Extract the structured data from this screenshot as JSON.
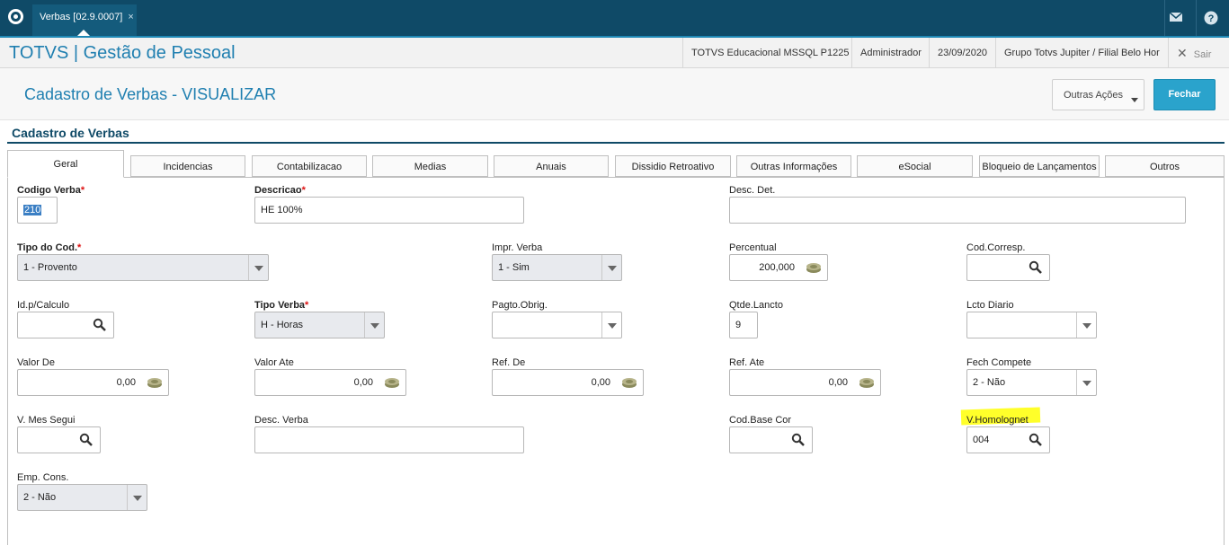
{
  "topbar": {
    "tab_label": "Verbas [02.9.0007]",
    "tab_close": "×",
    "mail_icon": "mail-icon",
    "help_icon": "help-icon"
  },
  "header": {
    "brand": "TOTVS | Gestão de Pessoal",
    "environment": "TOTVS Educacional MSSQL P1225",
    "user": "Administrador",
    "date": "23/09/2020",
    "company": "Grupo Totvs Jupiter / Filial Belo Hor",
    "exit_label": "Sair"
  },
  "titlebar": {
    "title": "Cadastro de Verbas - VISUALIZAR",
    "outras_acoes": "Outras Ações",
    "fechar": "Fechar"
  },
  "section_title": "Cadastro de Verbas",
  "tabs": [
    {
      "label": "Geral",
      "active": true
    },
    {
      "label": "Incidencias"
    },
    {
      "label": "Contabilizacao"
    },
    {
      "label": "Medias"
    },
    {
      "label": "Anuais"
    },
    {
      "label": "Dissidio Retroativo"
    },
    {
      "label": "Outras Informações"
    },
    {
      "label": "eSocial"
    },
    {
      "label": "Bloqueio de Lançamentos"
    },
    {
      "label": "Outros"
    }
  ],
  "fields": {
    "codigo_verba": {
      "label": "Codigo Verba",
      "value": "210"
    },
    "descricao": {
      "label": "Descricao",
      "value": "HE 100%"
    },
    "desc_det": {
      "label": "Desc. Det.",
      "value": ""
    },
    "tipo_cod": {
      "label": "Tipo do Cod.",
      "value": "1 - Provento"
    },
    "impr_verba": {
      "label": "Impr. Verba",
      "value": "1 - Sim"
    },
    "percentual": {
      "label": "Percentual",
      "value": "200,000"
    },
    "cod_corresp": {
      "label": "Cod.Corresp.",
      "value": ""
    },
    "id_calculo": {
      "label": "Id.p/Calculo",
      "value": ""
    },
    "tipo_verba": {
      "label": "Tipo Verba",
      "value": "H - Horas"
    },
    "pagto_obrig": {
      "label": "Pagto.Obrig.",
      "value": ""
    },
    "qtde_lancto": {
      "label": "Qtde.Lancto",
      "value": "9"
    },
    "lcto_diario": {
      "label": "Lcto Diario",
      "value": ""
    },
    "valor_de": {
      "label": "Valor De",
      "value": "0,00"
    },
    "valor_ate": {
      "label": "Valor Ate",
      "value": "0,00"
    },
    "ref_de": {
      "label": "Ref. De",
      "value": "0,00"
    },
    "ref_ate": {
      "label": "Ref. Ate",
      "value": "0,00"
    },
    "fech_compete": {
      "label": "Fech Compete",
      "value": "2 - Não"
    },
    "v_mes_segui": {
      "label": "V. Mes Segui",
      "value": ""
    },
    "desc_verba": {
      "label": "Desc. Verba",
      "value": ""
    },
    "cod_base_cor": {
      "label": "Cod.Base Cor",
      "value": ""
    },
    "v_homolognet": {
      "label": "V.Homolognet",
      "value": "004"
    },
    "emp_cons": {
      "label": "Emp. Cons.",
      "value": "2 - Não"
    }
  },
  "required_mark": "*",
  "colors": {
    "topbar": "#0f4a67",
    "accent": "#1f7fb0",
    "primary_button": "#2aa3cc",
    "highlight": "#ffff2a"
  }
}
